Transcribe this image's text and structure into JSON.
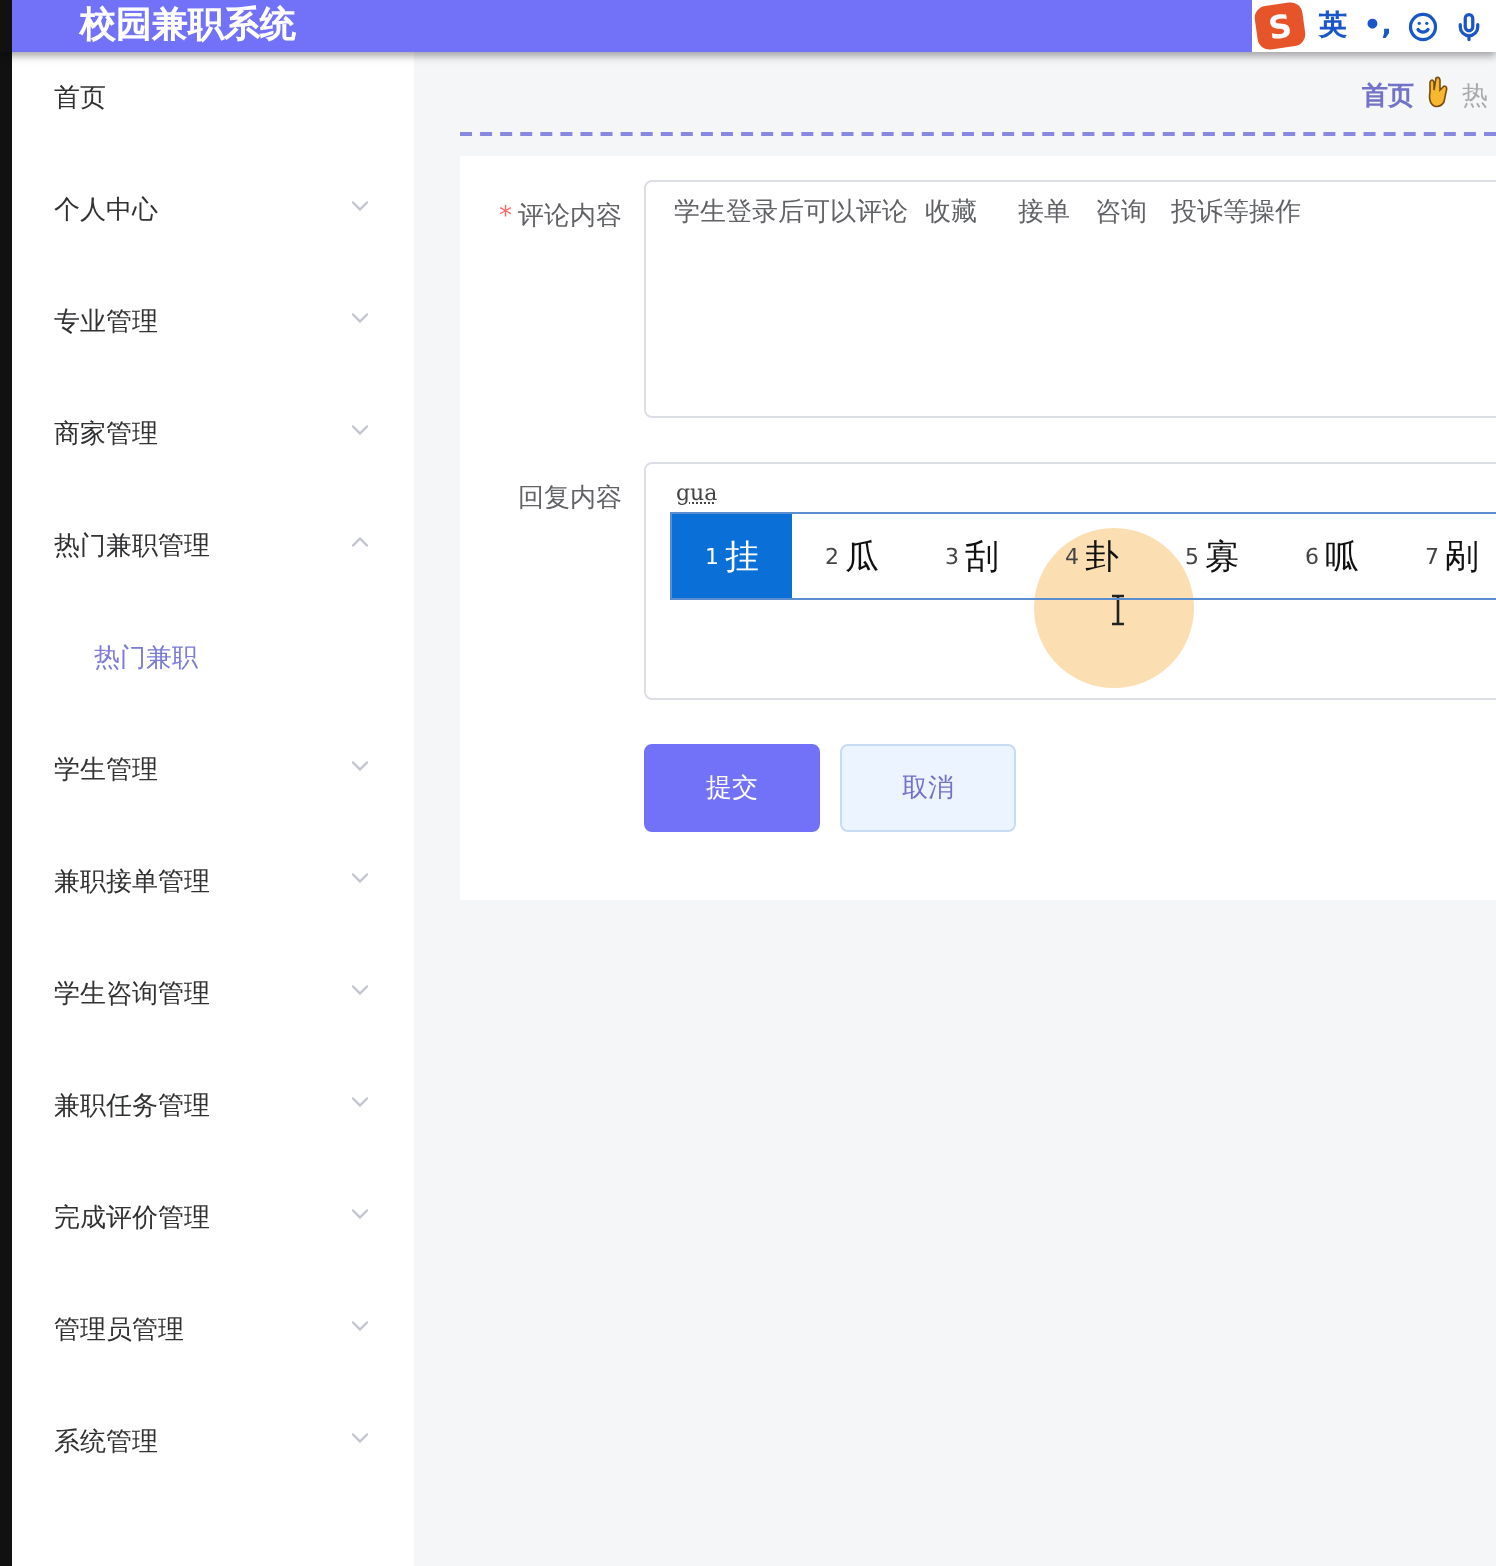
{
  "header": {
    "title": "校园兼职系统"
  },
  "ime_toolbar": {
    "logo": "S",
    "mode": "英",
    "punctuation": "•,"
  },
  "sidebar": {
    "items": [
      {
        "label": "首页",
        "kind": "link"
      },
      {
        "label": "个人中心",
        "kind": "menu",
        "expanded": false
      },
      {
        "label": "专业管理",
        "kind": "menu",
        "expanded": false
      },
      {
        "label": "商家管理",
        "kind": "menu",
        "expanded": false
      },
      {
        "label": "热门兼职管理",
        "kind": "menu",
        "expanded": true,
        "children": [
          {
            "label": "热门兼职",
            "selected": true
          }
        ]
      },
      {
        "label": "学生管理",
        "kind": "menu",
        "expanded": false
      },
      {
        "label": "兼职接单管理",
        "kind": "menu",
        "expanded": false
      },
      {
        "label": "学生咨询管理",
        "kind": "menu",
        "expanded": false
      },
      {
        "label": "兼职任务管理",
        "kind": "menu",
        "expanded": false
      },
      {
        "label": "完成评价管理",
        "kind": "menu",
        "expanded": false
      },
      {
        "label": "管理员管理",
        "kind": "menu",
        "expanded": false
      },
      {
        "label": "系统管理",
        "kind": "menu",
        "expanded": false
      }
    ]
  },
  "breadcrumb": [
    "首页",
    "热"
  ],
  "form": {
    "fields": [
      {
        "label": "评论内容",
        "marker": "*",
        "value": "学生登录后可以评论  收藏     接单   咨询   投诉等操作"
      },
      {
        "label": "回复内容",
        "value": "gua"
      }
    ],
    "buttons": [
      {
        "label": "提交",
        "kind": "primary"
      },
      {
        "label": "取消",
        "kind": "secondary"
      }
    ]
  },
  "ime_candidates": [
    {
      "number": "1",
      "text": "挂",
      "selected": true
    },
    {
      "number": "2",
      "text": "瓜",
      "selected": false
    },
    {
      "number": "3",
      "text": "刮",
      "selected": false
    },
    {
      "number": "4",
      "text": "卦",
      "selected": false
    },
    {
      "number": "5",
      "text": "寡",
      "selected": false
    },
    {
      "number": "6",
      "text": "呱",
      "selected": false
    },
    {
      "number": "7",
      "text": "剐",
      "selected": false
    }
  ]
}
